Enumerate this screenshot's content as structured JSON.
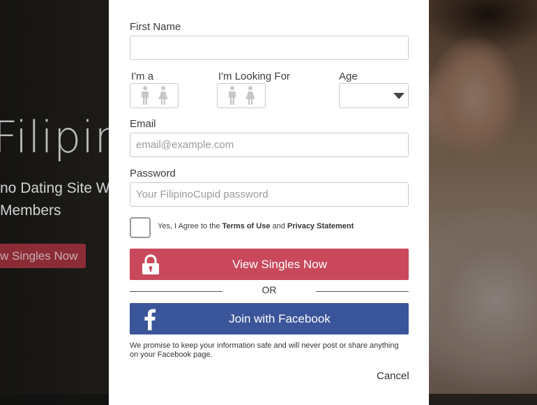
{
  "background": {
    "title": "Filipino",
    "subtitle_line1": "no Dating Site W",
    "subtitle_line2": "Members",
    "button_label": "w Singles Now"
  },
  "form": {
    "first_name": {
      "label": "First Name",
      "value": "",
      "placeholder": ""
    },
    "im_a": {
      "label": "I'm a",
      "options": [
        "male-icon",
        "female-icon"
      ]
    },
    "looking_for": {
      "label": "I'm Looking For",
      "options": [
        "male-icon",
        "female-icon"
      ]
    },
    "age": {
      "label": "Age",
      "selected": ""
    },
    "email": {
      "label": "Email",
      "value": "",
      "placeholder": "email@example.com"
    },
    "password": {
      "label": "Password",
      "value": "",
      "placeholder": "Your FilipinoCupid password"
    },
    "agree": {
      "prefix": "Yes, I Agree to the ",
      "terms": "Terms of Use",
      "and": " and ",
      "privacy": "Privacy Statement",
      "checked": false
    },
    "submit_label": "View Singles Now",
    "or_label": "OR",
    "facebook_label": "Join with Facebook",
    "promise": "We promise to keep your information safe and will never post or share anything on your Facebook page.",
    "cancel_label": "Cancel"
  },
  "colors": {
    "submit": "#c9485b",
    "facebook": "#3b559a",
    "hero_button": "#a0303c"
  }
}
